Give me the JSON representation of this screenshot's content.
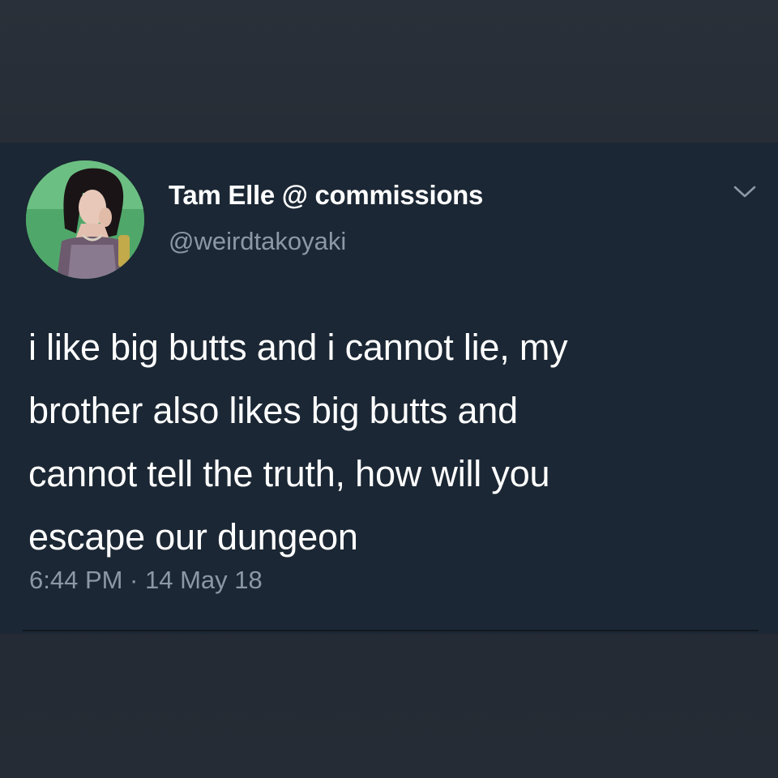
{
  "tweet": {
    "display_name": "Tam Elle @ commissions",
    "handle": "@weirdtakoyaki",
    "text_lines": [
      "i like big butts and i cannot lie, my",
      "brother also likes big butts and",
      "cannot tell the truth, how will you",
      "escape our dungeon"
    ],
    "timestamp": "6:44 PM · 14 May 18"
  },
  "icons": {
    "menu": "chevron-down-icon",
    "avatar": "avatar"
  },
  "colors": {
    "card_background": "#1b2734",
    "page_background": "#242a33",
    "primary_text": "#ffffff",
    "secondary_text": "#8b98a5"
  }
}
